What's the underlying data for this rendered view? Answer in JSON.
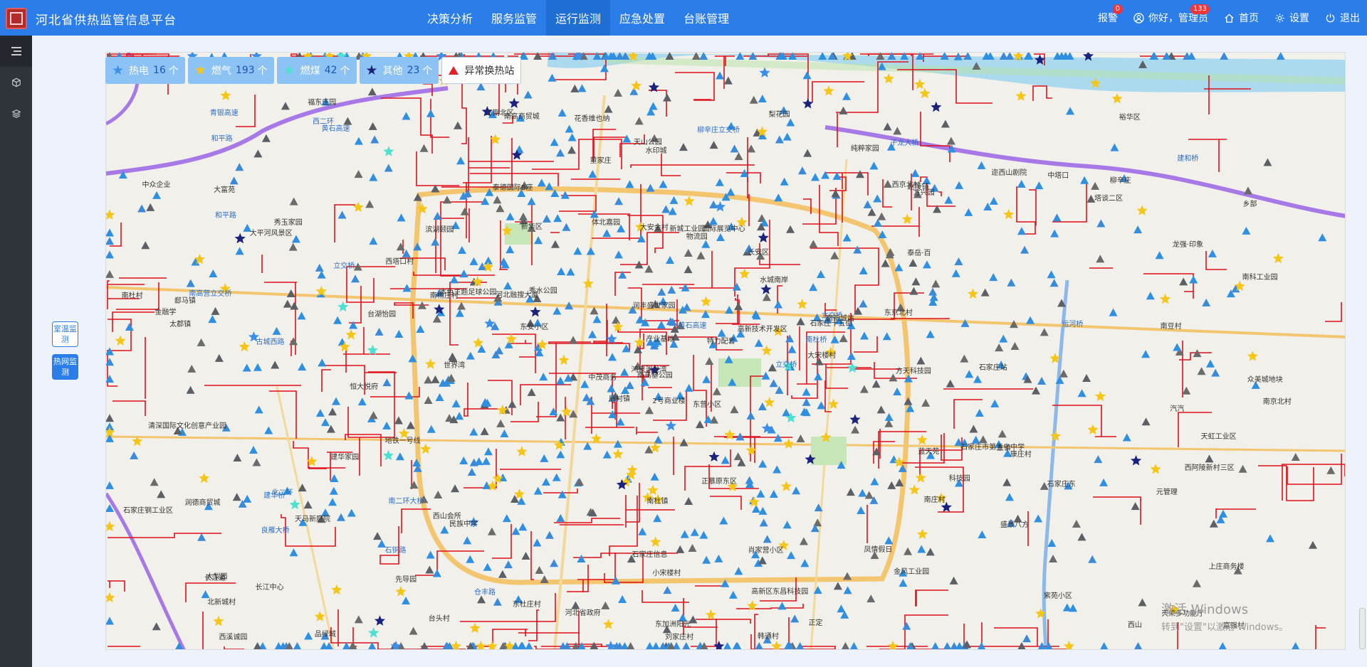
{
  "app": {
    "title": "河北省供热监管信息平台"
  },
  "nav": {
    "items": [
      "决策分析",
      "服务监管",
      "运行监测",
      "应急处置",
      "台账管理"
    ],
    "active": "运行监测"
  },
  "header_tools": {
    "alarm": {
      "label": "报警",
      "badge": "0"
    },
    "user": {
      "label": "你好，管理员",
      "badge": "133"
    },
    "home": "首页",
    "settings": "设置",
    "logout": "退出"
  },
  "side_toggles": [
    {
      "label": "室温监测",
      "active": false
    },
    {
      "label": "热网监测",
      "active": true
    }
  ],
  "legend": [
    {
      "label": "热电",
      "count": "16",
      "unit": "个",
      "color": "#3b8fe8"
    },
    {
      "label": "燃气",
      "count": "193",
      "unit": "个",
      "color": "#f5c518"
    },
    {
      "label": "燃煤",
      "count": "42",
      "unit": "个",
      "color": "#4fe0d2"
    },
    {
      "label": "其他",
      "count": "23",
      "unit": "个",
      "color": "#1a237e"
    }
  ],
  "abnormal_station": "异常换热站",
  "map_labels": [
    "东营小区",
    "大平河风景区",
    "南高基公园",
    "大梨园",
    "石家庄十五街",
    "民族中学",
    "子龙大桥",
    "国际展览中心",
    "赵陵铺",
    "立交桥",
    "黄石高速",
    "富强村",
    "古城西路",
    "乡部",
    "后村镇",
    "泰岳·百",
    "品绿城",
    "大安金村",
    "水城南岸",
    "天马新庭院",
    "秀水公园",
    "北新城村",
    "先导园",
    "新城工业园",
    "南新城站",
    "康庄村",
    "秀玉家园",
    "水印城",
    "太郡镇",
    "蓝天苑",
    "南科工业园",
    "鸿泉渊龙湾",
    "石家庄信息",
    "产业基地",
    "滨湖颐园",
    "迩西山剧院",
    "西山会所",
    "西山",
    "上庄商务楼",
    "主镇",
    "梨花园",
    "河北融搜大厦",
    "台湖怡园",
    "南庄村",
    "台头村",
    "南杜村",
    "南杜桥",
    "西溪诚园",
    "小宋楼村",
    "大宋楼村",
    "良雁大桥",
    "龙强·印象",
    "中众企业",
    "科技园",
    "金风工业园",
    "石铜路",
    "西二环",
    "青银高速",
    "肖家营小区",
    "柳辛庄",
    "柳辛庄立交桥",
    "世界湾",
    "南高营立交桥",
    "西塔口村",
    "中塔口",
    "福东庄园",
    "纯粹家园",
    "董家庄",
    "黄石高速",
    "石家庄钢工业区",
    "南杜镇",
    "东杜庄村",
    "石家庄市第五十中学",
    "南杨庄村",
    "长江道",
    "和平路",
    "立交桥",
    "清深国际文化创意产业园",
    "润丰盛世家园",
    "高新区东昌科技园",
    "高新技术开发区",
    "长江中心",
    "方天科技园",
    "西阿陵新村三区",
    "东加洲阳光",
    "南豆村",
    "正慕原东区",
    "紫苑小区",
    "韩通村",
    "凤情假日",
    "天山公园",
    "南京北村",
    "东京北村",
    "盛景八方",
    "特力配套",
    "元管理",
    "郄马镇",
    "刘家庄村",
    "西京北村",
    "方兴园",
    "恒大悦府",
    "三期北区",
    "众美城地块",
    "金融学",
    "建华家园",
    "南二环大桥",
    "仓丰路",
    "立交桥",
    "塔谈二区",
    "东安小区",
    "汽汽",
    "大富苑",
    "物流园",
    "中茂商务",
    "南高商贸城",
    "润德商贸城",
    "2号商业楼",
    "建和桥",
    "体北嘉园",
    "花香维也纳",
    "建华桥",
    "裕华区",
    "长安区",
    "新华区",
    "石家庄站",
    "地铁一号线",
    "天荣多功能厅",
    "河北省政府",
    "运河桥",
    "和平路",
    "北二环",
    "正定",
    "本色主题足球公园",
    "泰德国际B座",
    "天虹工业区",
    "石家庄东"
  ],
  "watermark": {
    "line1": "激活 Windows",
    "line2": "转到\"设置\"以激活 Windows。"
  }
}
